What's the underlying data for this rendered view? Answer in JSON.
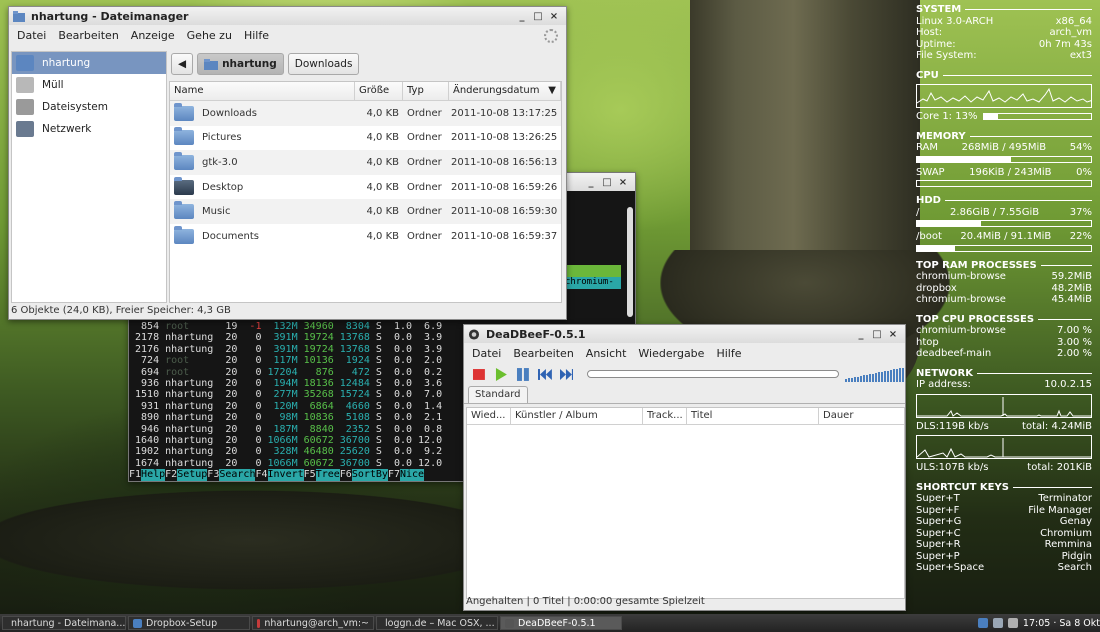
{
  "file_manager": {
    "title": "nhartung - Dateimanager",
    "menu": [
      "Datei",
      "Bearbeiten",
      "Anzeige",
      "Gehe zu",
      "Hilfe"
    ],
    "sidebar": [
      {
        "label": "nhartung",
        "selected": true,
        "icon": "home-folder-icon"
      },
      {
        "label": "Müll",
        "selected": false,
        "icon": "trash-icon"
      },
      {
        "label": "Dateisystem",
        "selected": false,
        "icon": "drive-icon"
      },
      {
        "label": "Netzwerk",
        "selected": false,
        "icon": "network-icon"
      }
    ],
    "path": {
      "back": "◀",
      "current": "nhartung",
      "next": "Downloads"
    },
    "columns": [
      "Name",
      "Größe",
      "Typ",
      "Änderungsdatum"
    ],
    "rows": [
      {
        "name": "Downloads",
        "size": "4,0 KB",
        "type": "Ordner",
        "date": "2011-10-08 13:17:25",
        "icon": "folder-icon"
      },
      {
        "name": "Pictures",
        "size": "4,0 KB",
        "type": "Ordner",
        "date": "2011-10-08 13:26:25",
        "icon": "folder-icon"
      },
      {
        "name": "gtk-3.0",
        "size": "4,0 KB",
        "type": "Ordner",
        "date": "2011-10-08 16:56:13",
        "icon": "folder-icon"
      },
      {
        "name": "Desktop",
        "size": "4,0 KB",
        "type": "Ordner",
        "date": "2011-10-08 16:59:26",
        "icon": "desktop-folder-icon"
      },
      {
        "name": "Music",
        "size": "4,0 KB",
        "type": "Ordner",
        "date": "2011-10-08 16:59:30",
        "icon": "folder-icon"
      },
      {
        "name": "Documents",
        "size": "4,0 KB",
        "type": "Ordner",
        "date": "2011-10-08 16:59:37",
        "icon": "folder-icon"
      }
    ],
    "status": "6 Objekte (24,0 KB), Freier Speicher: 4,3 GB"
  },
  "terminal": {
    "chromium_label": "chromium-",
    "processes": [
      {
        "pid": "854",
        "user": "root",
        "pri": "19",
        "ni": "-1",
        "virt": "132M",
        "res": "34960",
        "shr": "8304",
        "s": "S",
        "cpu": "1.0",
        "mem": "6.9"
      },
      {
        "pid": "2178",
        "user": "nhartung",
        "pri": "20",
        "ni": "0",
        "virt": "391M",
        "res": "19724",
        "shr": "13768",
        "s": "S",
        "cpu": "0.0",
        "mem": "3.9"
      },
      {
        "pid": "2176",
        "user": "nhartung",
        "pri": "20",
        "ni": "0",
        "virt": "391M",
        "res": "19724",
        "shr": "13768",
        "s": "S",
        "cpu": "0.0",
        "mem": "3.9"
      },
      {
        "pid": "724",
        "user": "root",
        "pri": "20",
        "ni": "0",
        "virt": "117M",
        "res": "10136",
        "shr": "1924",
        "s": "S",
        "cpu": "0.0",
        "mem": "2.0"
      },
      {
        "pid": "694",
        "user": "root",
        "pri": "20",
        "ni": "0",
        "virt": "17204",
        "res": "876",
        "shr": "472",
        "s": "S",
        "cpu": "0.0",
        "mem": "0.2"
      },
      {
        "pid": "936",
        "user": "nhartung",
        "pri": "20",
        "ni": "0",
        "virt": "194M",
        "res": "18136",
        "shr": "12484",
        "s": "S",
        "cpu": "0.0",
        "mem": "3.6"
      },
      {
        "pid": "1510",
        "user": "nhartung",
        "pri": "20",
        "ni": "0",
        "virt": "277M",
        "res": "35268",
        "shr": "15724",
        "s": "S",
        "cpu": "0.0",
        "mem": "7.0"
      },
      {
        "pid": "931",
        "user": "nhartung",
        "pri": "20",
        "ni": "0",
        "virt": "120M",
        "res": "6864",
        "shr": "4660",
        "s": "S",
        "cpu": "0.0",
        "mem": "1.4"
      },
      {
        "pid": "890",
        "user": "nhartung",
        "pri": "20",
        "ni": "0",
        "virt": "98M",
        "res": "10836",
        "shr": "5108",
        "s": "S",
        "cpu": "0.0",
        "mem": "2.1"
      },
      {
        "pid": "946",
        "user": "nhartung",
        "pri": "20",
        "ni": "0",
        "virt": "187M",
        "res": "8840",
        "shr": "2352",
        "s": "S",
        "cpu": "0.0",
        "mem": "0.8"
      },
      {
        "pid": "1640",
        "user": "nhartung",
        "pri": "20",
        "ni": "0",
        "virt": "1066M",
        "res": "60672",
        "shr": "36700",
        "s": "S",
        "cpu": "0.0",
        "mem": "12.0"
      },
      {
        "pid": "1902",
        "user": "nhartung",
        "pri": "20",
        "ni": "0",
        "virt": "328M",
        "res": "46480",
        "shr": "25620",
        "s": "S",
        "cpu": "0.0",
        "mem": "9.2"
      },
      {
        "pid": "1674",
        "user": "nhartung",
        "pri": "20",
        "ni": "0",
        "virt": "1066M",
        "res": "60672",
        "shr": "36700",
        "s": "S",
        "cpu": "0.0",
        "mem": "12.0"
      }
    ],
    "fkeys": [
      {
        "k": "F1",
        "v": "Help  "
      },
      {
        "k": "F2",
        "v": "Setup "
      },
      {
        "k": "F3",
        "v": "Search"
      },
      {
        "k": "F4",
        "v": "Invert"
      },
      {
        "k": "F5",
        "v": "Tree  "
      },
      {
        "k": "F6",
        "v": "SortBy"
      },
      {
        "k": "F7",
        "v": "Nice"
      }
    ]
  },
  "deadbeef": {
    "title": "DeaDBeeF-0.5.1",
    "menu": [
      "Datei",
      "Bearbeiten",
      "Ansicht",
      "Wiedergabe",
      "Hilfe"
    ],
    "tab": "Standard",
    "columns": [
      "Wied...",
      "Künstler / Album",
      "Track...",
      "Titel",
      "Dauer"
    ],
    "status": "Angehalten | 0 Titel | 0:00:00 gesamte Spielzeit"
  },
  "conky": {
    "system": {
      "header": "SYSTEM",
      "rows": [
        {
          "l": "Linux 3.0-ARCH",
          "r": "x86_64"
        },
        {
          "l": "Host:",
          "r": "arch_vm"
        },
        {
          "l": "Uptime:",
          "r": "0h 7m 43s"
        },
        {
          "l": "File System:",
          "r": "ext3"
        }
      ]
    },
    "cpu": {
      "header": "CPU",
      "core_label": "Core 1: 13%",
      "core_value": 0.13
    },
    "memory": {
      "header": "MEMORY",
      "ram": {
        "l": "RAM",
        "mid": "268MiB / 495MiB",
        "r": "54%",
        "value": 0.54
      },
      "swap": {
        "l": "SWAP",
        "mid": "196KiB / 243MiB",
        "r": "0%",
        "value": 0.0
      }
    },
    "hdd": {
      "header": "HDD",
      "root": {
        "l": "/",
        "mid": "2.86GiB / 7.55GiB",
        "r": "37%",
        "value": 0.37
      },
      "boot": {
        "l": "/boot",
        "mid": "20.4MiB / 91.1MiB",
        "r": "22%",
        "value": 0.22
      }
    },
    "top_ram": {
      "header": "TOP RAM PROCESSES",
      "rows": [
        {
          "l": "chromium-browse",
          "r": "59.2MiB"
        },
        {
          "l": "dropbox",
          "r": "48.2MiB"
        },
        {
          "l": "chromium-browse",
          "r": "45.4MiB"
        }
      ]
    },
    "top_cpu": {
      "header": "TOP CPU PROCESSES",
      "rows": [
        {
          "l": "chromium-browse",
          "r": "7.00 %"
        },
        {
          "l": "htop",
          "r": "3.00 %"
        },
        {
          "l": "deadbeef-main",
          "r": "2.00 %"
        }
      ]
    },
    "network": {
      "header": "NETWORK",
      "ip": {
        "l": "IP address:",
        "r": "10.0.2.15"
      },
      "dl": {
        "l": "DLS:119B kb/s",
        "r": "total: 4.24MiB"
      },
      "ul": {
        "l": "ULS:107B kb/s",
        "r": "total: 201KiB"
      }
    },
    "shortcuts": {
      "header": "SHORTCUT KEYS",
      "rows": [
        {
          "l": "Super+T",
          "r": "Terminator"
        },
        {
          "l": "Super+F",
          "r": "File Manager"
        },
        {
          "l": "Super+G",
          "r": "Genay"
        },
        {
          "l": "Super+C",
          "r": "Chromium"
        },
        {
          "l": "Super+R",
          "r": "Remmina"
        },
        {
          "l": "Super+P",
          "r": "Pidgin"
        },
        {
          "l": "Super+Space",
          "r": "Search"
        }
      ]
    }
  },
  "taskbar": {
    "tasks": [
      {
        "label": "nhartung - Dateimana...",
        "active": false
      },
      {
        "label": "Dropbox-Setup",
        "active": false
      },
      {
        "label": "nhartung@arch_vm:~",
        "active": false
      },
      {
        "label": "loggn.de – Mac OSX, ...",
        "active": false
      },
      {
        "label": "DeaDBeeF-0.5.1",
        "active": true
      }
    ],
    "clock": "17:05 · Sa  8 Okt"
  },
  "colors": {
    "selection": "#7895c0",
    "accent": "#4a7fbf",
    "htop_cyan": "#2aa7a7"
  }
}
